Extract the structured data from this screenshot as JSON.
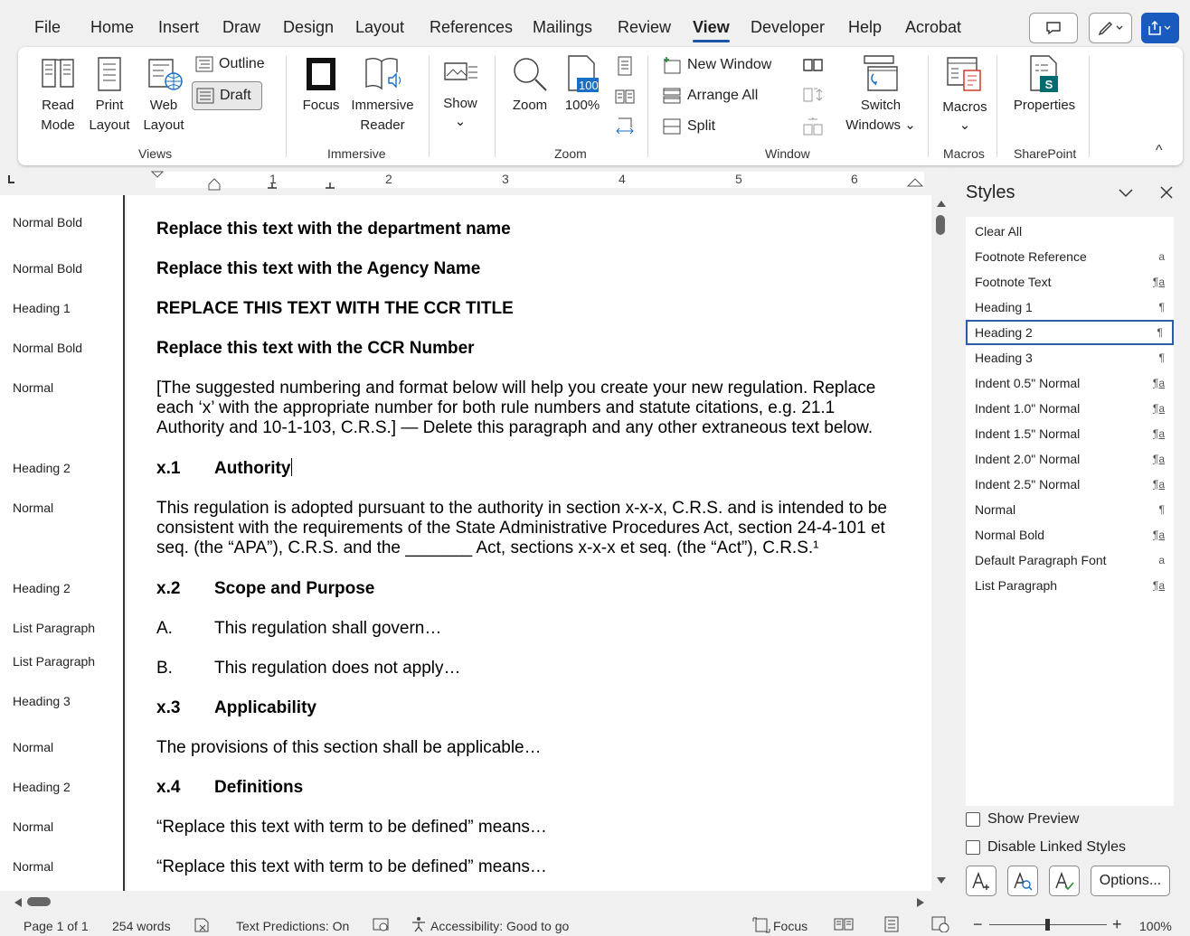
{
  "menu": {
    "tabs": [
      "File",
      "Home",
      "Insert",
      "Draw",
      "Design",
      "Layout",
      "References",
      "Mailings",
      "Review",
      "View",
      "Developer",
      "Help",
      "Acrobat"
    ],
    "active_tab": "View"
  },
  "ribbon": {
    "views": {
      "read_mode_1": "Read",
      "read_mode_2": "Mode",
      "print_1": "Print",
      "print_2": "Layout",
      "web_1": "Web",
      "web_2": "Layout",
      "outline": "Outline",
      "draft": "Draft",
      "group": "Views"
    },
    "immersive": {
      "focus": "Focus",
      "reader_1": "Immersive",
      "reader_2": "Reader",
      "group": "Immersive"
    },
    "show": {
      "label": "Show",
      "chevron": "⌄"
    },
    "zoom": {
      "zoom": "Zoom",
      "pct": "100%",
      "badge": "100",
      "group": "Zoom"
    },
    "window": {
      "new_window": "New Window",
      "arrange_all": "Arrange All",
      "split": "Split",
      "switch_1": "Switch",
      "switch_2": "Windows ⌄",
      "group": "Window"
    },
    "macros": {
      "label": "Macros",
      "chevron": "⌄",
      "group": "Macros"
    },
    "sharepoint": {
      "label": "Properties",
      "group": "SharePoint"
    },
    "collapse": "^"
  },
  "ruler": {
    "numbers": [
      "1",
      "2",
      "3",
      "4",
      "5",
      "6"
    ]
  },
  "style_area": [
    "Normal Bold",
    "Normal Bold",
    "Heading 1",
    "Normal Bold",
    "Normal",
    "Heading 2",
    "Normal",
    "Heading 2",
    "List Paragraph",
    "List Paragraph",
    "Heading 3",
    "Normal",
    "Heading 2",
    "Normal",
    "Normal"
  ],
  "document": {
    "dept": "Replace this text with the department name",
    "agency": "Replace this text with the Agency Name",
    "ccr_title": "REPLACE THIS TEXT WITH THE CCR TITLE",
    "ccr_number": "Replace this text with the CCR Number",
    "note": [
      "[The suggested numbering and format below will help you create your new regulation. Replace",
      "each ‘x’ with the appropriate number for both rule numbers and statute citations, e.g. 21.1",
      "Authority and 10-1-103, C.R.S.] — Delete this paragraph and any other extraneous text below."
    ],
    "h_authority": {
      "num": "x.1",
      "text": "Authority"
    },
    "authority_para": [
      "This regulation is adopted pursuant to the authority in section x-x-x, C.R.S. and is intended to be",
      "consistent with the requirements of the State Administrative Procedures Act, section 24-4-101 et",
      "seq. (the “APA”), C.R.S. and the _______ Act, sections x-x-x et seq. (the “Act”), C.R.S.¹"
    ],
    "h_scope": {
      "num": "x.2",
      "text": "Scope and Purpose"
    },
    "list_a": {
      "num": "A.",
      "text": "This regulation shall govern…"
    },
    "list_b": {
      "num": "B.",
      "text": "This regulation does not apply…"
    },
    "h_applic": {
      "num": "x.3",
      "text": "Applicability"
    },
    "applic_para": "The provisions of this section shall be applicable…",
    "h_def": {
      "num": "x.4",
      "text": "Definitions"
    },
    "def1": "“Replace this text with term to be defined” means…",
    "def2": "“Replace this text with term to be defined” means…"
  },
  "styles_pane": {
    "title": "Styles",
    "items": [
      {
        "name": "Clear All",
        "glyph": ""
      },
      {
        "name": "Footnote Reference",
        "glyph": "a"
      },
      {
        "name": "Footnote Text",
        "glyph": "¶a"
      },
      {
        "name": "Heading 1",
        "glyph": "¶"
      },
      {
        "name": "Heading 2",
        "glyph": "¶"
      },
      {
        "name": "Heading 3",
        "glyph": "¶"
      },
      {
        "name": "Indent 0.5\" Normal",
        "glyph": "¶a"
      },
      {
        "name": "Indent 1.0\" Normal",
        "glyph": "¶a"
      },
      {
        "name": "Indent 1.5\" Normal",
        "glyph": "¶a"
      },
      {
        "name": "Indent 2.0\" Normal",
        "glyph": "¶a"
      },
      {
        "name": "Indent 2.5\" Normal",
        "glyph": "¶a"
      },
      {
        "name": "Normal",
        "glyph": "¶"
      },
      {
        "name": "Normal Bold",
        "glyph": "¶a"
      },
      {
        "name": "Default Paragraph Font",
        "glyph": "a"
      },
      {
        "name": "List Paragraph",
        "glyph": "¶a"
      }
    ],
    "selected": "Heading 2",
    "show_preview": "Show Preview",
    "disable_linked": "Disable Linked Styles",
    "options": "Options..."
  },
  "status": {
    "page": "Page 1 of 1",
    "words": "254 words",
    "predictions": "Text Predictions: On",
    "accessibility": "Accessibility: Good to go",
    "focus": "Focus",
    "zoom": "100%"
  }
}
